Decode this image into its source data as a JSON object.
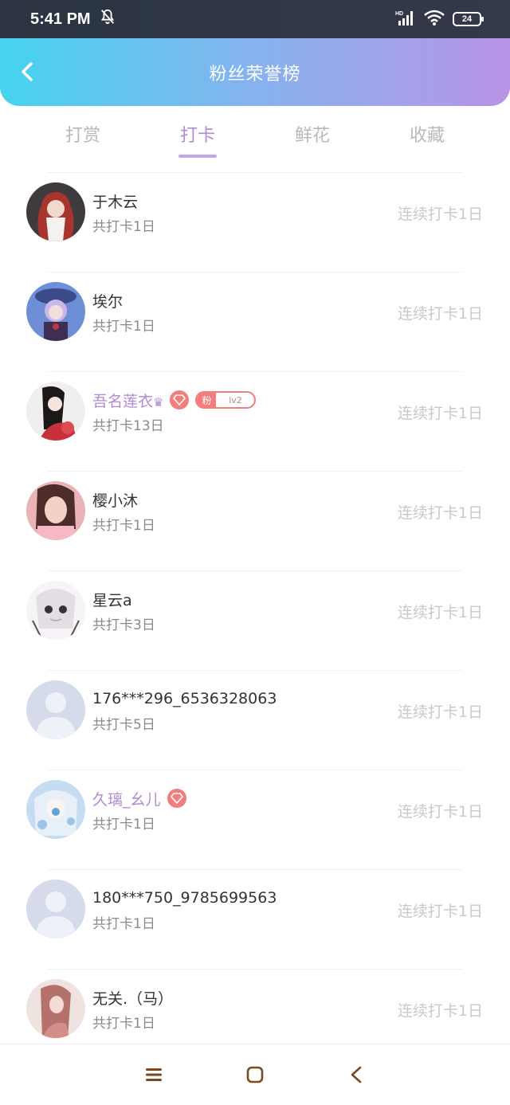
{
  "status_bar": {
    "time": "5:41 PM",
    "battery": "24"
  },
  "header": {
    "title": "粉丝荣誉榜"
  },
  "tabs": [
    {
      "label": "打赏",
      "active": false
    },
    {
      "label": "打卡",
      "active": true
    },
    {
      "label": "鲜花",
      "active": false
    },
    {
      "label": "收藏",
      "active": false
    }
  ],
  "fans": [
    {
      "name": "于木云",
      "total": "共打卡1日",
      "streak": "连续打卡1日",
      "vip": false
    },
    {
      "name": "埃尔",
      "total": "共打卡1日",
      "streak": "连续打卡1日",
      "vip": false
    },
    {
      "name": "吾名莲衣",
      "total": "共打卡13日",
      "streak": "连续打卡1日",
      "vip": true,
      "crown": "♛",
      "badge": {
        "left": "粉",
        "right": "lv2"
      }
    },
    {
      "name": "樱小沐",
      "total": "共打卡1日",
      "streak": "连续打卡1日",
      "vip": false
    },
    {
      "name": "星云a",
      "total": "共打卡3日",
      "streak": "连续打卡1日",
      "vip": false
    },
    {
      "name": "176***296_6536328063",
      "total": "共打卡5日",
      "streak": "连续打卡1日",
      "vip": false
    },
    {
      "name": "久璃_幺儿",
      "total": "共打卡1日",
      "streak": "连续打卡1日",
      "vip": true
    },
    {
      "name": "180***750_9785699563",
      "total": "共打卡1日",
      "streak": "连续打卡1日",
      "vip": false
    },
    {
      "name": "无关.（马）",
      "total": "共打卡1日",
      "streak": "连续打卡1日",
      "vip": false
    }
  ]
}
